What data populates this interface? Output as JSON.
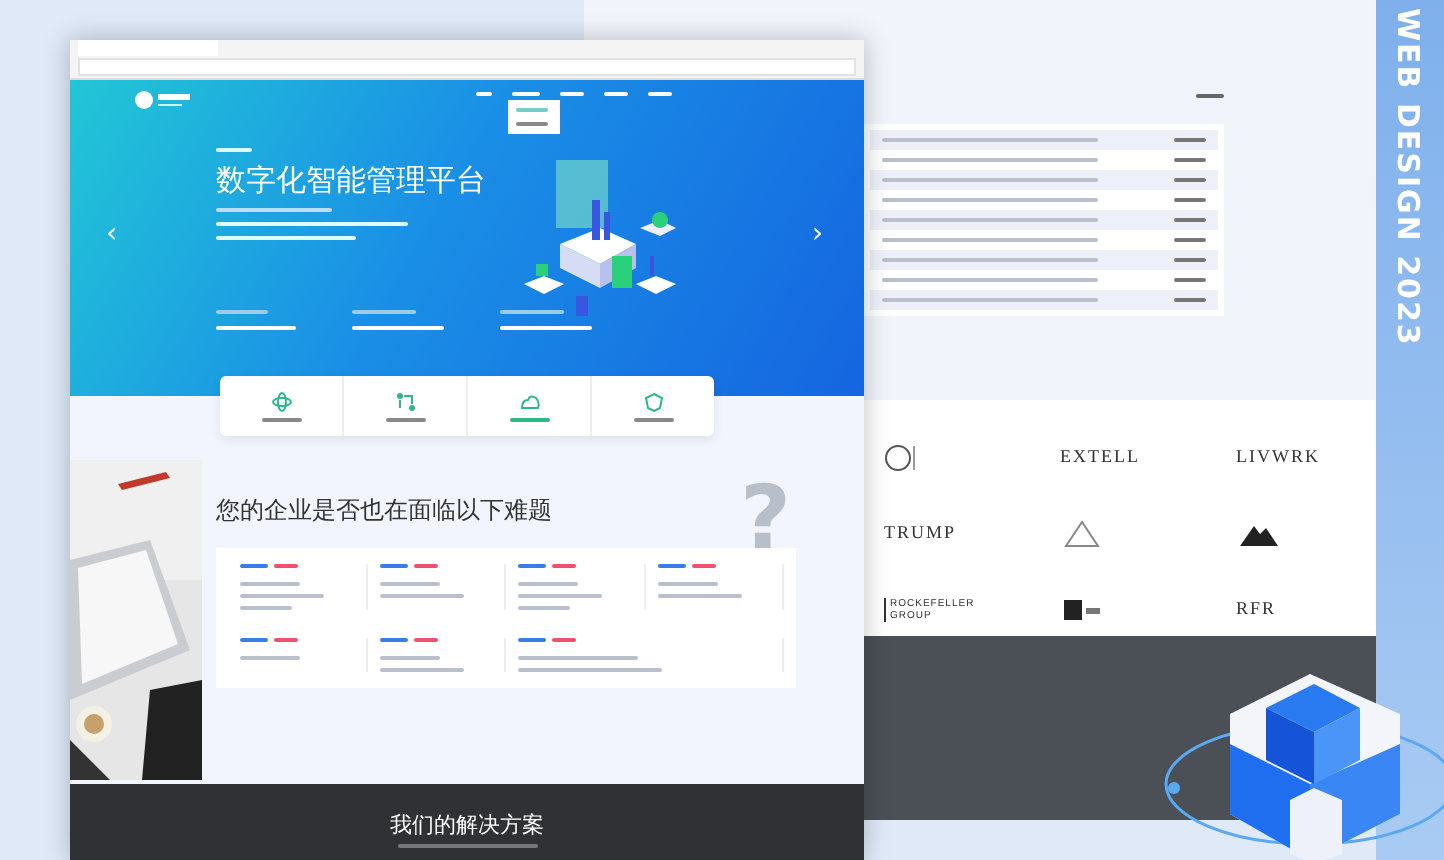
{
  "hero": {
    "title": "数字化智能管理平台",
    "prev": "‹",
    "next": "›"
  },
  "features": [
    {
      "selected": false
    },
    {
      "selected": false
    },
    {
      "selected": true
    },
    {
      "selected": false
    }
  ],
  "problems": {
    "title": "您的企业是否也在面临以下难题",
    "decor": "?"
  },
  "solutions": {
    "title": "我们的解决方案"
  },
  "partners": [
    {
      "kind": "mark"
    },
    {
      "kind": "text",
      "name": "EXTELL"
    },
    {
      "kind": "text",
      "name": "LIVWRK"
    },
    {
      "kind": "text",
      "name": "TRUMP"
    },
    {
      "kind": "mark"
    },
    {
      "kind": "mark"
    },
    {
      "kind": "text",
      "name": "ROCKEFELLER GROUP"
    },
    {
      "kind": "mark"
    },
    {
      "kind": "text",
      "name": "RFR"
    }
  ],
  "side_label": "WEB DESIGN 2023"
}
